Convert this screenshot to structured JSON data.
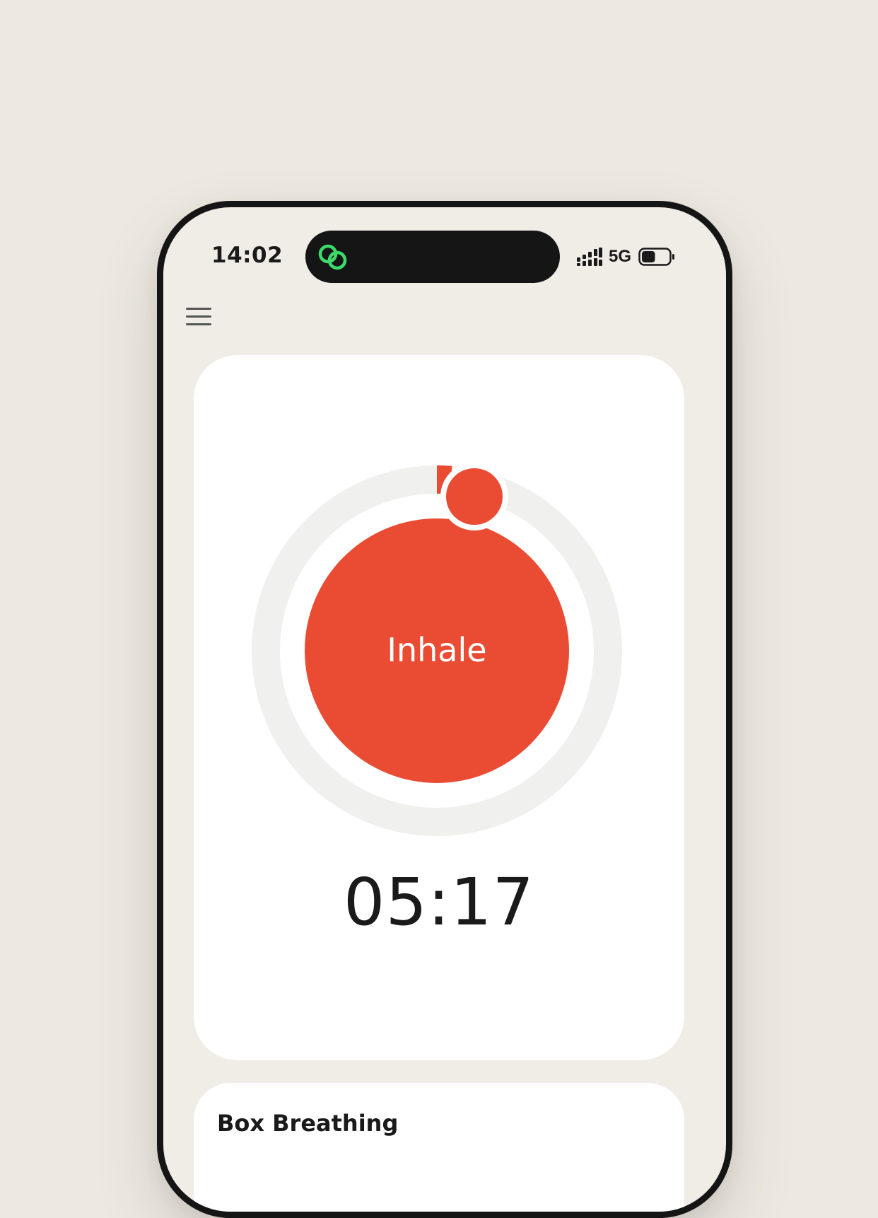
{
  "status_bar": {
    "time": "14:02",
    "network": "5G",
    "battery_level": 0.5
  },
  "icons": {
    "menu": "hamburger-menu-icon",
    "island": "linked-circles-icon",
    "signal": "cellular-signal-icon",
    "battery": "battery-icon"
  },
  "colors": {
    "background": "#ede9e2",
    "accent": "#ea4c33",
    "track": "#f0f0ef",
    "island_icon": "#3ddc6a"
  },
  "timer": {
    "phase": "Inhale",
    "time_remaining": "05:17",
    "cycle_progress": 0.013
  },
  "exercise": {
    "title": "Box Breathing"
  }
}
